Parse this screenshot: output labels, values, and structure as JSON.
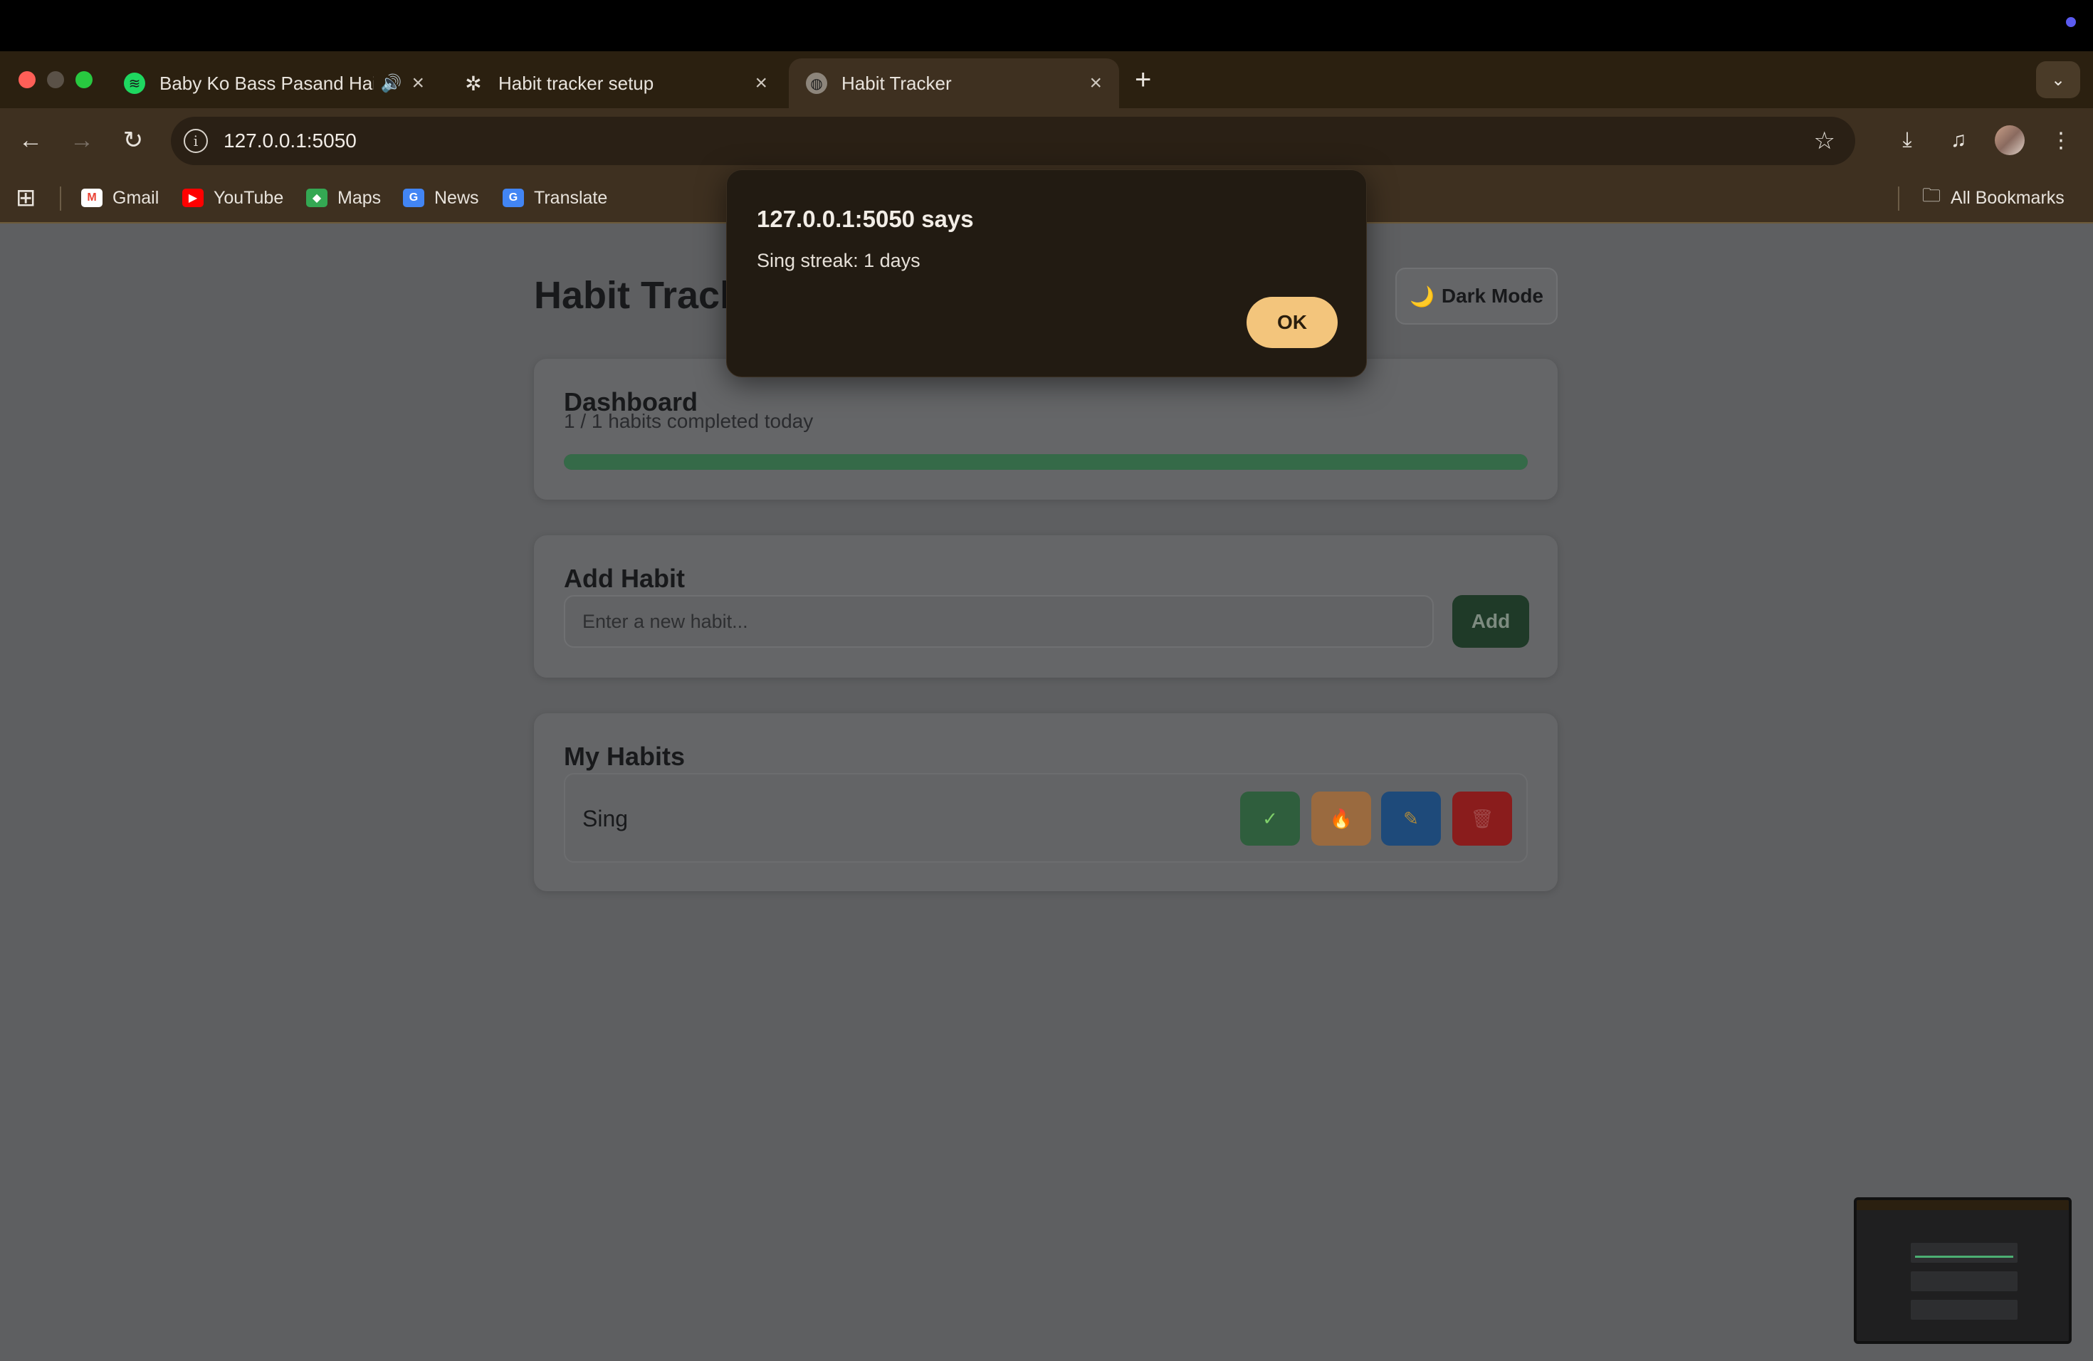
{
  "browser": {
    "tabs": [
      {
        "title": "Baby Ko Bass Pasand Hai",
        "favicon": "spotify-icon",
        "audio": true
      },
      {
        "title": "Habit tracker setup",
        "favicon": "openai-icon"
      },
      {
        "title": "Habit Tracker",
        "favicon": "globe-icon",
        "active": true
      }
    ],
    "url": "127.0.0.1:5050",
    "bookmarks": [
      {
        "label": "Gmail",
        "icon": "gmail-icon"
      },
      {
        "label": "YouTube",
        "icon": "youtube-icon"
      },
      {
        "label": "Maps",
        "icon": "maps-icon"
      },
      {
        "label": "News",
        "icon": "news-icon"
      },
      {
        "label": "Translate",
        "icon": "translate-icon"
      }
    ],
    "all_bookmarks": "All Bookmarks"
  },
  "app": {
    "title": "Habit Track",
    "dark_mode_label": "Dark Mode",
    "dashboard": {
      "heading": "Dashboard",
      "summary": "1 / 1 habits completed today",
      "progress_fraction": 1.0
    },
    "add_habit": {
      "heading": "Add Habit",
      "placeholder": "Enter a new habit...",
      "button": "Add"
    },
    "my_habits": {
      "heading": "My Habits",
      "items": [
        {
          "name": "Sing",
          "actions": [
            "complete-icon",
            "streak-icon",
            "edit-icon",
            "delete-icon"
          ]
        }
      ]
    }
  },
  "dialog": {
    "title": "127.0.0.1:5050 says",
    "message": "Sing streak: 1 days",
    "ok": "OK"
  },
  "colors": {
    "accent_green": "#356a48",
    "ok_button": "#f3c57c",
    "complete_btn": "#2f5e3d",
    "streak_btn": "#9a6a3f",
    "edit_btn": "#1e4a7a",
    "delete_btn": "#8a1c1c"
  }
}
